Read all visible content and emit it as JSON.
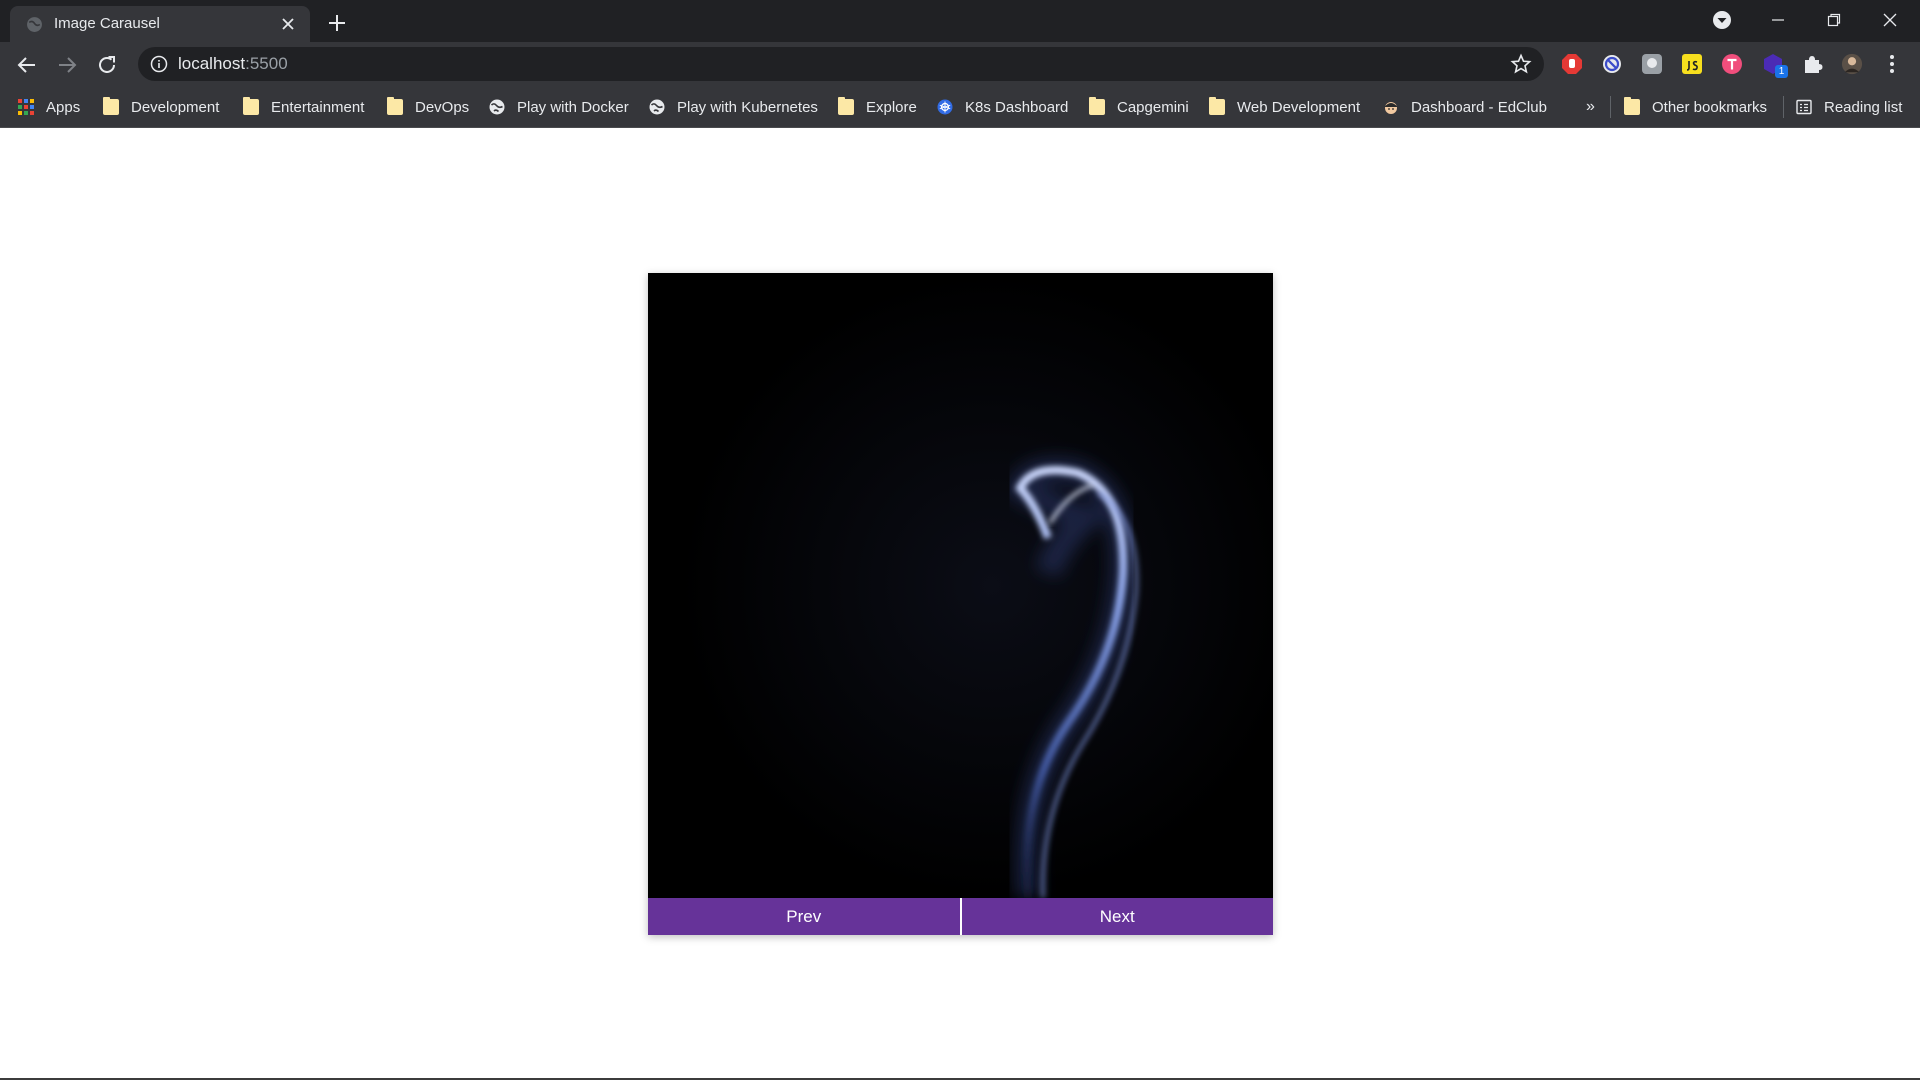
{
  "browser": {
    "tab": {
      "title": "Image Carausel"
    },
    "address": {
      "host": "localhost",
      "port": ":5500"
    },
    "bookmarks": [
      {
        "label": "Apps",
        "icon": "apps-grid-icon"
      },
      {
        "label": "Development",
        "icon": "folder-icon"
      },
      {
        "label": "Entertainment",
        "icon": "folder-icon"
      },
      {
        "label": "DevOps",
        "icon": "folder-icon"
      },
      {
        "label": "Play with Docker",
        "icon": "globe-icon"
      },
      {
        "label": "Play with Kubernetes",
        "icon": "globe-icon"
      },
      {
        "label": "Explore",
        "icon": "folder-icon"
      },
      {
        "label": "K8s Dashboard",
        "icon": "kubernetes-icon"
      },
      {
        "label": "Capgemini",
        "icon": "folder-icon"
      },
      {
        "label": "Web Development",
        "icon": "folder-icon"
      },
      {
        "label": "Dashboard - EdClub",
        "icon": "edclub-icon"
      }
    ],
    "overflow_label": "»",
    "other_bookmarks": "Other bookmarks",
    "reading_list": "Reading list",
    "extension_badge": "1"
  },
  "carousel": {
    "prev_label": "Prev",
    "next_label": "Next",
    "image": "smoke-wisp-image"
  },
  "colors": {
    "accent": "#663399",
    "chrome_dark": "#202124",
    "chrome_mid": "#35363a"
  }
}
